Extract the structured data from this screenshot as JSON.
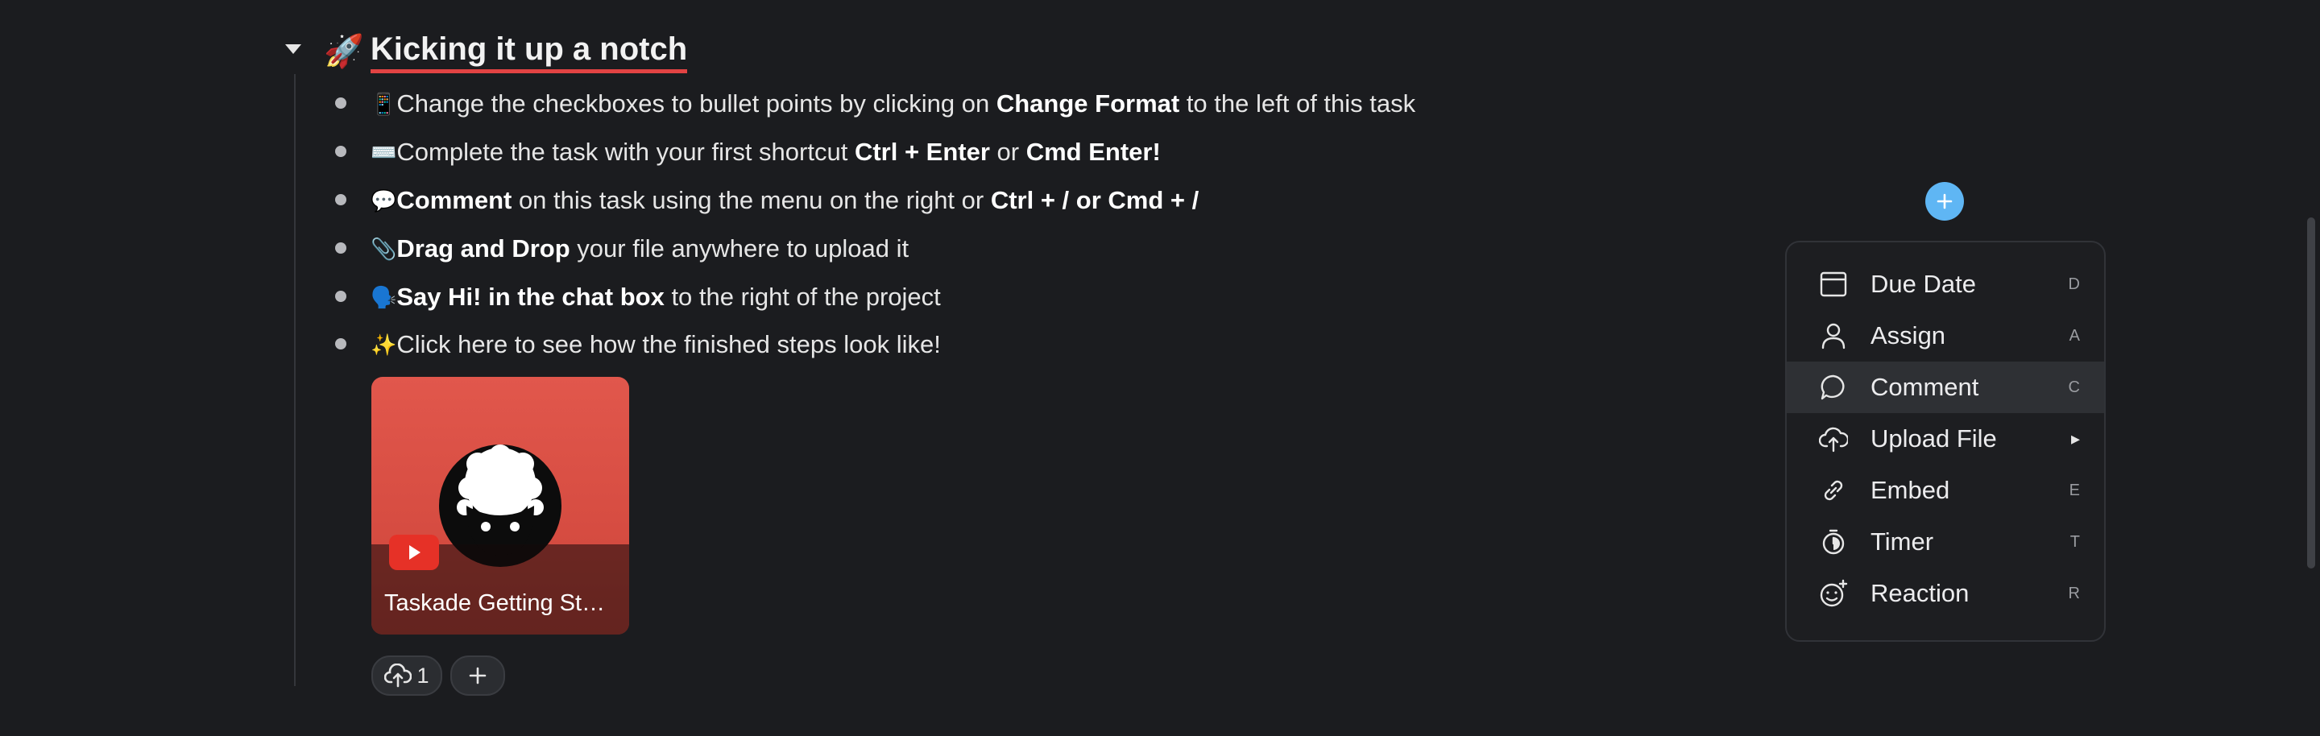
{
  "heading": {
    "emoji": "🚀",
    "title": "Kicking it up a notch"
  },
  "items": [
    {
      "segments": [
        {
          "t": "📱",
          "emo": true
        },
        {
          "t": "Change the checkboxes to bullet points by clicking on "
        },
        {
          "t": "Change Format",
          "b": true
        },
        {
          "t": " to the left of this task"
        }
      ]
    },
    {
      "segments": [
        {
          "t": "⌨️",
          "emo": true
        },
        {
          "t": "Complete the task with your first shortcut "
        },
        {
          "t": "Ctrl + Enter",
          "b": true
        },
        {
          "t": " or "
        },
        {
          "t": "Cmd Enter!",
          "b": true
        }
      ]
    },
    {
      "segments": [
        {
          "t": "💬",
          "emo": true
        },
        {
          "t": "Comment",
          "b": true
        },
        {
          "t": " on this task using the menu on the right or "
        },
        {
          "t": "Ctrl + / or Cmd + /",
          "b": true
        }
      ]
    },
    {
      "segments": [
        {
          "t": "📎",
          "emo": true
        },
        {
          "t": "Drag and Drop",
          "b": true
        },
        {
          "t": " your file anywhere to upload it"
        }
      ]
    },
    {
      "segments": [
        {
          "t": "🗣️",
          "emo": true
        },
        {
          "t": "Say Hi! in the chat box",
          "b": true
        },
        {
          "t": " to the right of the project"
        }
      ]
    },
    {
      "segments": [
        {
          "t": "✨",
          "emo": true
        },
        {
          "t": "Click here to see how the finished steps look like!"
        }
      ]
    }
  ],
  "video": {
    "caption": "Taskade Getting St…",
    "icon": "youtube-play-icon"
  },
  "actions": {
    "upload_count": "1",
    "upload_icon": "cloud-upload-icon",
    "add_icon": "plus-icon"
  },
  "menu": {
    "items": [
      {
        "label": "Due Date",
        "shortcut": "D",
        "icon": "calendar-icon"
      },
      {
        "label": "Assign",
        "shortcut": "A",
        "icon": "user-icon"
      },
      {
        "label": "Comment",
        "shortcut": "C",
        "icon": "comment-icon",
        "active": true
      },
      {
        "label": "Upload File",
        "shortcut": "▸",
        "icon": "cloud-upload-icon"
      },
      {
        "label": "Embed",
        "shortcut": "E",
        "icon": "link-icon"
      },
      {
        "label": "Timer",
        "shortcut": "T",
        "icon": "timer-icon"
      },
      {
        "label": "Reaction",
        "shortcut": "R",
        "icon": "smile-plus-icon"
      }
    ]
  },
  "colors": {
    "accent": "#5fb6f4",
    "underline": "#e24343",
    "background": "#1b1c1f"
  }
}
